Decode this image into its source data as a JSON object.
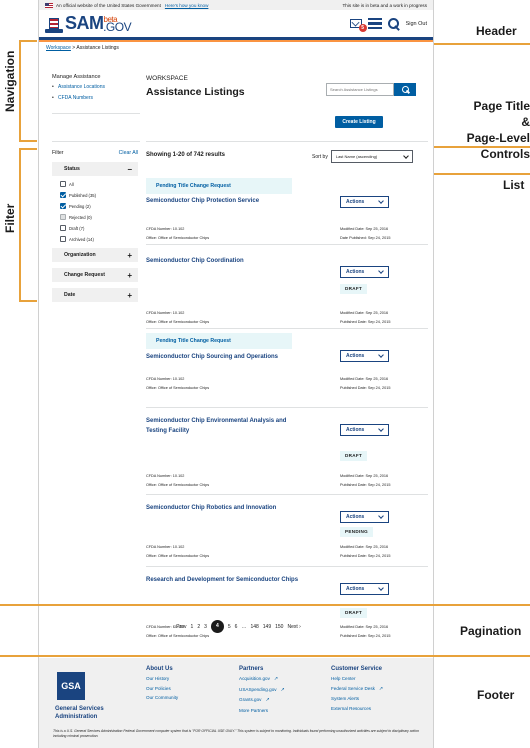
{
  "gov_banner": {
    "text": "An official website of the United States Government",
    "link": "Here's how you know",
    "beta_note": "This site is in beta and a work in progress"
  },
  "header": {
    "logo_main": "SAM",
    "logo_beta": "beta",
    "logo_gov": ".GOV",
    "notification_count": "5",
    "signout": "Sign Out"
  },
  "breadcrumb": {
    "root": "Workspace",
    "sep": " > ",
    "current": "Assistance Listings"
  },
  "top_search": {
    "placeholder": "Search Assistance Listings"
  },
  "nav": {
    "title": "Manage Assistance",
    "items": [
      "Assistance Locations",
      "CFDA Numbers"
    ]
  },
  "page": {
    "eyebrow": "WORKSPACE",
    "title": "Assistance Listings",
    "create_button": "Create Listing"
  },
  "filter": {
    "label": "Filter",
    "clear": "Clear All",
    "status_title": "Status",
    "status_sign": "−",
    "options": [
      {
        "label": "All",
        "state": "off"
      },
      {
        "label": "Published (35)",
        "state": "on"
      },
      {
        "label": "Pending (2)",
        "state": "on"
      },
      {
        "label": "Rejected (0)",
        "state": "dis"
      },
      {
        "label": "Draft (7)",
        "state": "off"
      },
      {
        "label": "Archived (14)",
        "state": "off"
      }
    ],
    "sections": [
      "Organization",
      "Change Request",
      "Date"
    ],
    "plus": "+"
  },
  "results": {
    "summary": "Showing 1-20 of 742 results",
    "sort_label": "Sort by",
    "sort_value": "Last Name (ascending)"
  },
  "list": {
    "actions_label": "Actions",
    "items": [
      {
        "banner": "Pending Title Change Request",
        "title": "Semiconductor Chip Protection Service",
        "tag": "",
        "cfda": "CFDA Number: 10.102",
        "office": "Office: Office of Semiconductor Chips",
        "modified": "Modified Date: Sep 25, 2016",
        "published": "Date Published: Sep 24, 2015"
      },
      {
        "banner": "",
        "title": "Semiconductor Chip Coordination",
        "tag": "DRAFT",
        "cfda": "CFDA Number: 10.102",
        "office": "Office: Office of Semiconductor Chips",
        "modified": "Modified Date: Sep 25, 2016",
        "published": "Published Date: Sep 24, 2015"
      },
      {
        "banner": "Pending Title Change Request",
        "title": "Semiconductor Chip Sourcing and Operations",
        "tag": "",
        "cfda": "CFDA Number: 10.102",
        "office": "Office: Office of Semiconductor Chips",
        "modified": "Modified Date: Sep 25, 2016",
        "published": "Published Date: Sep 24, 2015"
      },
      {
        "banner": "",
        "title": "Semiconductor Chip Environmental Analysis and Testing Facility",
        "tag": "DRAFT",
        "cfda": "CFDA Number: 10.102",
        "office": "Office: Office of Semiconductor Chips",
        "modified": "Modified Date: Sep 25, 2016",
        "published": "Published Date: Sep 24, 2015"
      },
      {
        "banner": "",
        "title": "Semiconductor Chip Robotics and Innovation",
        "tag": "PENDING",
        "cfda": "CFDA Number: 10.102",
        "office": "Office: Office of Semiconductor Chips",
        "modified": "Modified Date: Sep 25, 2016",
        "published": "Published Date: Sep 24, 2015"
      },
      {
        "banner": "",
        "title": "Research and Development for Semiconductor Chips",
        "tag": "DRAFT",
        "cfda": "CFDA Number: 10.102",
        "office": "Office: Office of Semiconductor Chips",
        "modified": "Modified Date: Sep 25, 2016",
        "published": "Published Date: Sep 24, 2015"
      }
    ]
  },
  "pagination": {
    "prev": "‹ Prev",
    "pages": [
      "1",
      "2",
      "3"
    ],
    "current": "4",
    "after": [
      "5",
      "6",
      "…",
      "148",
      "149",
      "150"
    ],
    "next": "Next ›"
  },
  "footer": {
    "logo": "GSA",
    "org": "General Services Administration",
    "cols": [
      {
        "title": "About Us",
        "links": [
          "Our History",
          "Our Policies",
          "Our Community"
        ],
        "ext": [
          false,
          false,
          false
        ]
      },
      {
        "title": "Partners",
        "links": [
          "Acquisition.gov",
          "USASpending.gov",
          "Grants.gov",
          "More Partners"
        ],
        "ext": [
          true,
          true,
          true,
          false
        ]
      },
      {
        "title": "Customer Service",
        "links": [
          "Help Center",
          "Federal Service Desk",
          "System Alerts",
          "External Resources"
        ],
        "ext": [
          false,
          true,
          false,
          false
        ]
      }
    ],
    "disclaimer": "This is a U.S. General Services Administration Federal Government computer system that is \"FOR OFFICIAL USE ONLY.\" This system is subject to monitoring. Individuals found performing unauthorized activities are subject to disciplinary action including criminal prosecution."
  },
  "annotations": {
    "header": "Header",
    "page_title_1": "Page Title &",
    "page_title_2": "Page-Level",
    "page_title_3": "Controls",
    "list": "List",
    "pagination": "Pagination",
    "footer": "Footer",
    "navigation": "Navigation",
    "filter": "Filter"
  },
  "colors": {
    "accent": "#005ea2",
    "brand": "#1a4480",
    "annotation_line": "#e8a23b"
  }
}
